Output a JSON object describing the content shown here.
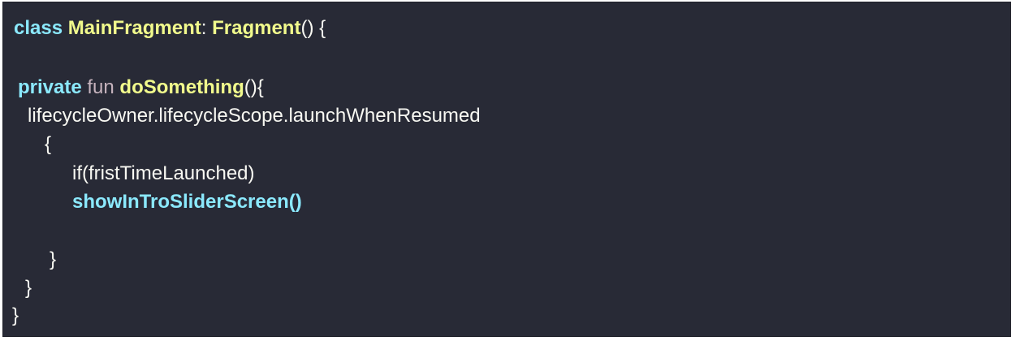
{
  "code": {
    "line1": {
      "keyword": "class",
      "space1": " ",
      "class_name": "MainFragment",
      "colon": ": ",
      "parent": "Fragment",
      "tail": "() {"
    },
    "line3": {
      "private": "private",
      "space1": " ",
      "fun": "fun",
      "space2": " ",
      "method": "doSomething",
      "tail": "(){"
    },
    "line4": "lifecycleOwner.lifecycleScope.launchWhenResumed",
    "line5": "{",
    "line6": "if(fristTimeLaunched)",
    "line7": "showInTroSliderScreen()",
    "line9": "}",
    "line10": "}",
    "line11": "}"
  },
  "colors": {
    "background": "#282a36",
    "keyword": "#8be9fd",
    "fun_keyword": "#c6b3bd",
    "name": "#f1fa8c",
    "text": "#f8f8f2"
  }
}
